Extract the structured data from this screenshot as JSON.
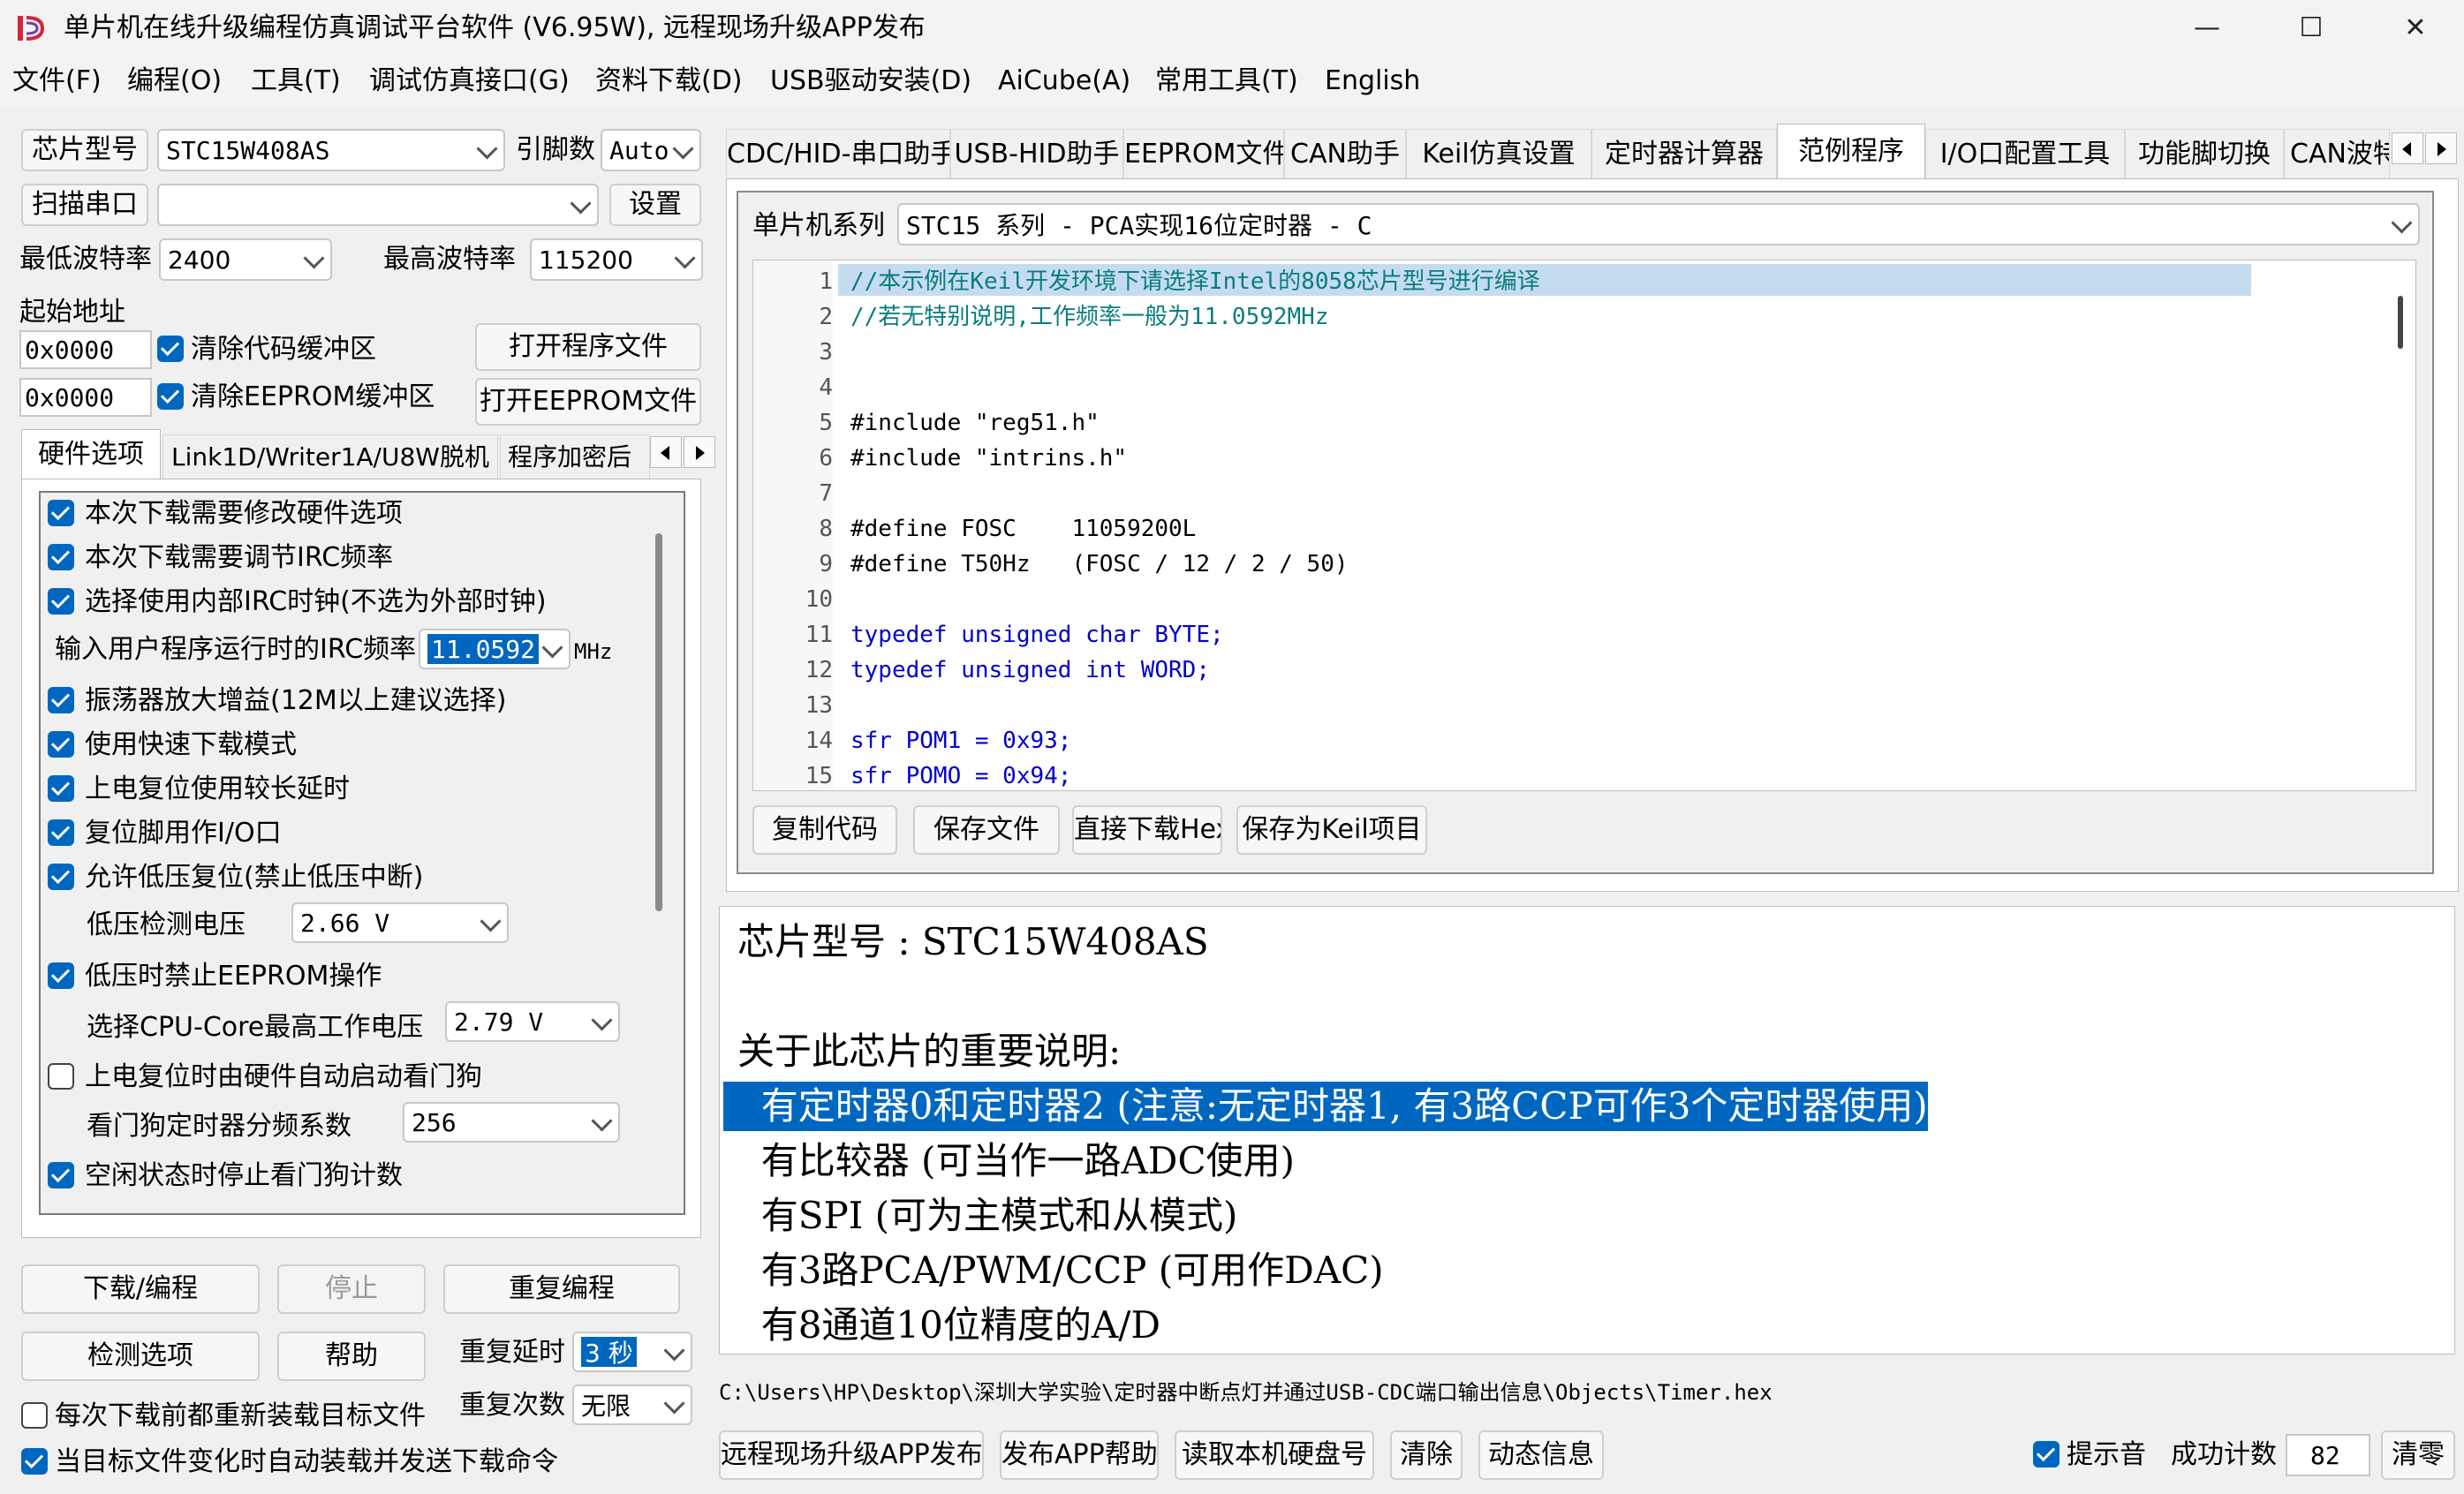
{
  "window": {
    "title": "单片机在线升级编程仿真调试平台软件 (V6.95W), 远程现场升级APP发布",
    "controls": {
      "minimize": "—",
      "maximize": "☐",
      "close": "✕"
    }
  },
  "menu": [
    "文件(F)",
    "编程(O)",
    "工具(T)",
    "调试仿真接口(G)",
    "资料下载(D)",
    "USB驱动安装(D)",
    "AiCube(A)",
    "常用工具(T)",
    "English"
  ],
  "left": {
    "chip_model_label": "芯片型号",
    "chip_model_value": "STC15W408AS",
    "pins_label": "引脚数",
    "pins_value": "Auto",
    "scan_port_label": "扫描串口",
    "port_value": "",
    "settings_label": "设置",
    "min_baud_label": "最低波特率",
    "min_baud_value": "2400",
    "max_baud_label": "最高波特率",
    "max_baud_value": "115200",
    "start_addr_label": "起始地址",
    "code_addr": "0x0000",
    "clear_code_label": "清除代码缓冲区",
    "open_program_label": "打开程序文件",
    "eeprom_addr": "0x0000",
    "clear_eeprom_label": "清除EEPROM缓冲区",
    "open_eeprom_label": "打开EEPROM文件",
    "tabs": [
      "硬件选项",
      "Link1D/Writer1A/U8W脱机",
      "程序加密后"
    ],
    "options": {
      "opt1": "本次下载需要修改硬件选项",
      "opt2": "本次下载需要调节IRC频率",
      "opt3": "选择使用内部IRC时钟(不选为外部时钟)",
      "irc_label": "输入用户程序运行时的IRC频率",
      "irc_value": "11.0592",
      "irc_unit": "MHz",
      "opt4": "振荡器放大增益(12M以上建议选择)",
      "opt5": "使用快速下载模式",
      "opt6": "上电复位使用较长延时",
      "opt7": "复位脚用作I/O口",
      "opt8": "允许低压复位(禁止低压中断)",
      "lv_label": "低压检测电压",
      "lv_value": "2.66 V",
      "opt9": "低压时禁止EEPROM操作",
      "cpu_label": "选择CPU-Core最高工作电压",
      "cpu_value": "2.79 V",
      "opt10": "上电复位时由硬件自动启动看门狗",
      "wdt_label": "看门狗定时器分频系数",
      "wdt_value": "256",
      "opt11": "空闲状态时停止看门狗计数"
    },
    "download_label": "下载/编程",
    "stop_label": "停止",
    "reprogram_label": "重复编程",
    "check_label": "检测选项",
    "help_label": "帮助",
    "repeat_delay_label": "重复延时",
    "repeat_delay_value": "3 秒",
    "repeat_count_label": "重复次数",
    "repeat_count_value": "无限",
    "reload_label": "每次下载前都重新装载目标文件",
    "auto_label": "当目标文件变化时自动装载并发送下载命令"
  },
  "right": {
    "tabs": [
      "CDC/HID-串口助手",
      "USB-HID助手",
      "EEPROM文件",
      "CAN助手",
      "Keil仿真设置",
      "定时器计算器",
      "范例程序",
      "I/O口配置工具",
      "功能脚切换",
      "CAN波特"
    ],
    "series_label": "单片机系列",
    "series_value": "STC15 系列 - PCA实现16位定时器 - C",
    "code": [
      {
        "n": "1",
        "t": "//本示例在Keil开发环境下请选择Intel的8058芯片型号进行编译",
        "k": "cm"
      },
      {
        "n": "2",
        "t": "//若无特别说明,工作频率一般为11.0592MHz",
        "k": "cm"
      },
      {
        "n": "3",
        "t": "",
        "k": "pp"
      },
      {
        "n": "4",
        "t": "",
        "k": "pp"
      },
      {
        "n": "5",
        "t": "#include \"reg51.h\"",
        "k": "pp"
      },
      {
        "n": "6",
        "t": "#include \"intrins.h\"",
        "k": "pp"
      },
      {
        "n": "7",
        "t": "",
        "k": "pp"
      },
      {
        "n": "8",
        "t": "#define FOSC    11059200L",
        "k": "pp"
      },
      {
        "n": "9",
        "t": "#define T50Hz   (FOSC / 12 / 2 / 50)",
        "k": "pp"
      },
      {
        "n": "10",
        "t": "",
        "k": "pp"
      },
      {
        "n": "11",
        "t": "typedef unsigned char BYTE;",
        "k": "kw"
      },
      {
        "n": "12",
        "t": "typedef unsigned int WORD;",
        "k": "kw"
      },
      {
        "n": "13",
        "t": "",
        "k": "pp"
      },
      {
        "n": "14",
        "t": "sfr POM1 = 0x93;",
        "k": "kw"
      },
      {
        "n": "15",
        "t": "sfr POMO = 0x94;",
        "k": "kw"
      }
    ],
    "copy_label": "复制代码",
    "save_label": "保存文件",
    "download_hex_label": "直接下载Hex",
    "save_keil_label": "保存为Keil项目",
    "info": [
      "芯片型号 : STC15W408AS",
      "",
      "关于此芯片的重要说明:",
      "  有定时器0和定时器2 (注意:无定时器1, 有3路CCP可作3个定时器使用)",
      "  有比较器 (可当作一路ADC使用)",
      "  有SPI (可为主模式和从模式)",
      "  有3路PCA/PWM/CCP (可用作DAC)",
      "  有8通道10位精度的A/D"
    ],
    "file_path": "C:\\Users\\HP\\Desktop\\深圳大学实验\\定时器中断点灯并通过USB-CDC端口输出信息\\Objects\\Timer.hex"
  },
  "bottom": {
    "remote_label": "远程现场升级APP发布",
    "app_help_label": "发布APP帮助",
    "read_disk_label": "读取本机硬盘号",
    "clear_label": "清除",
    "dynamic_label": "动态信息",
    "sound_label": "提示音",
    "success_label": "成功计数",
    "success_value": "82",
    "reset_label": "清零"
  },
  "colors": {
    "accent": "#0067c0",
    "code_highlight": "#c5dcf0",
    "comment": "#0a7d7d",
    "keyword": "#0000cc"
  }
}
